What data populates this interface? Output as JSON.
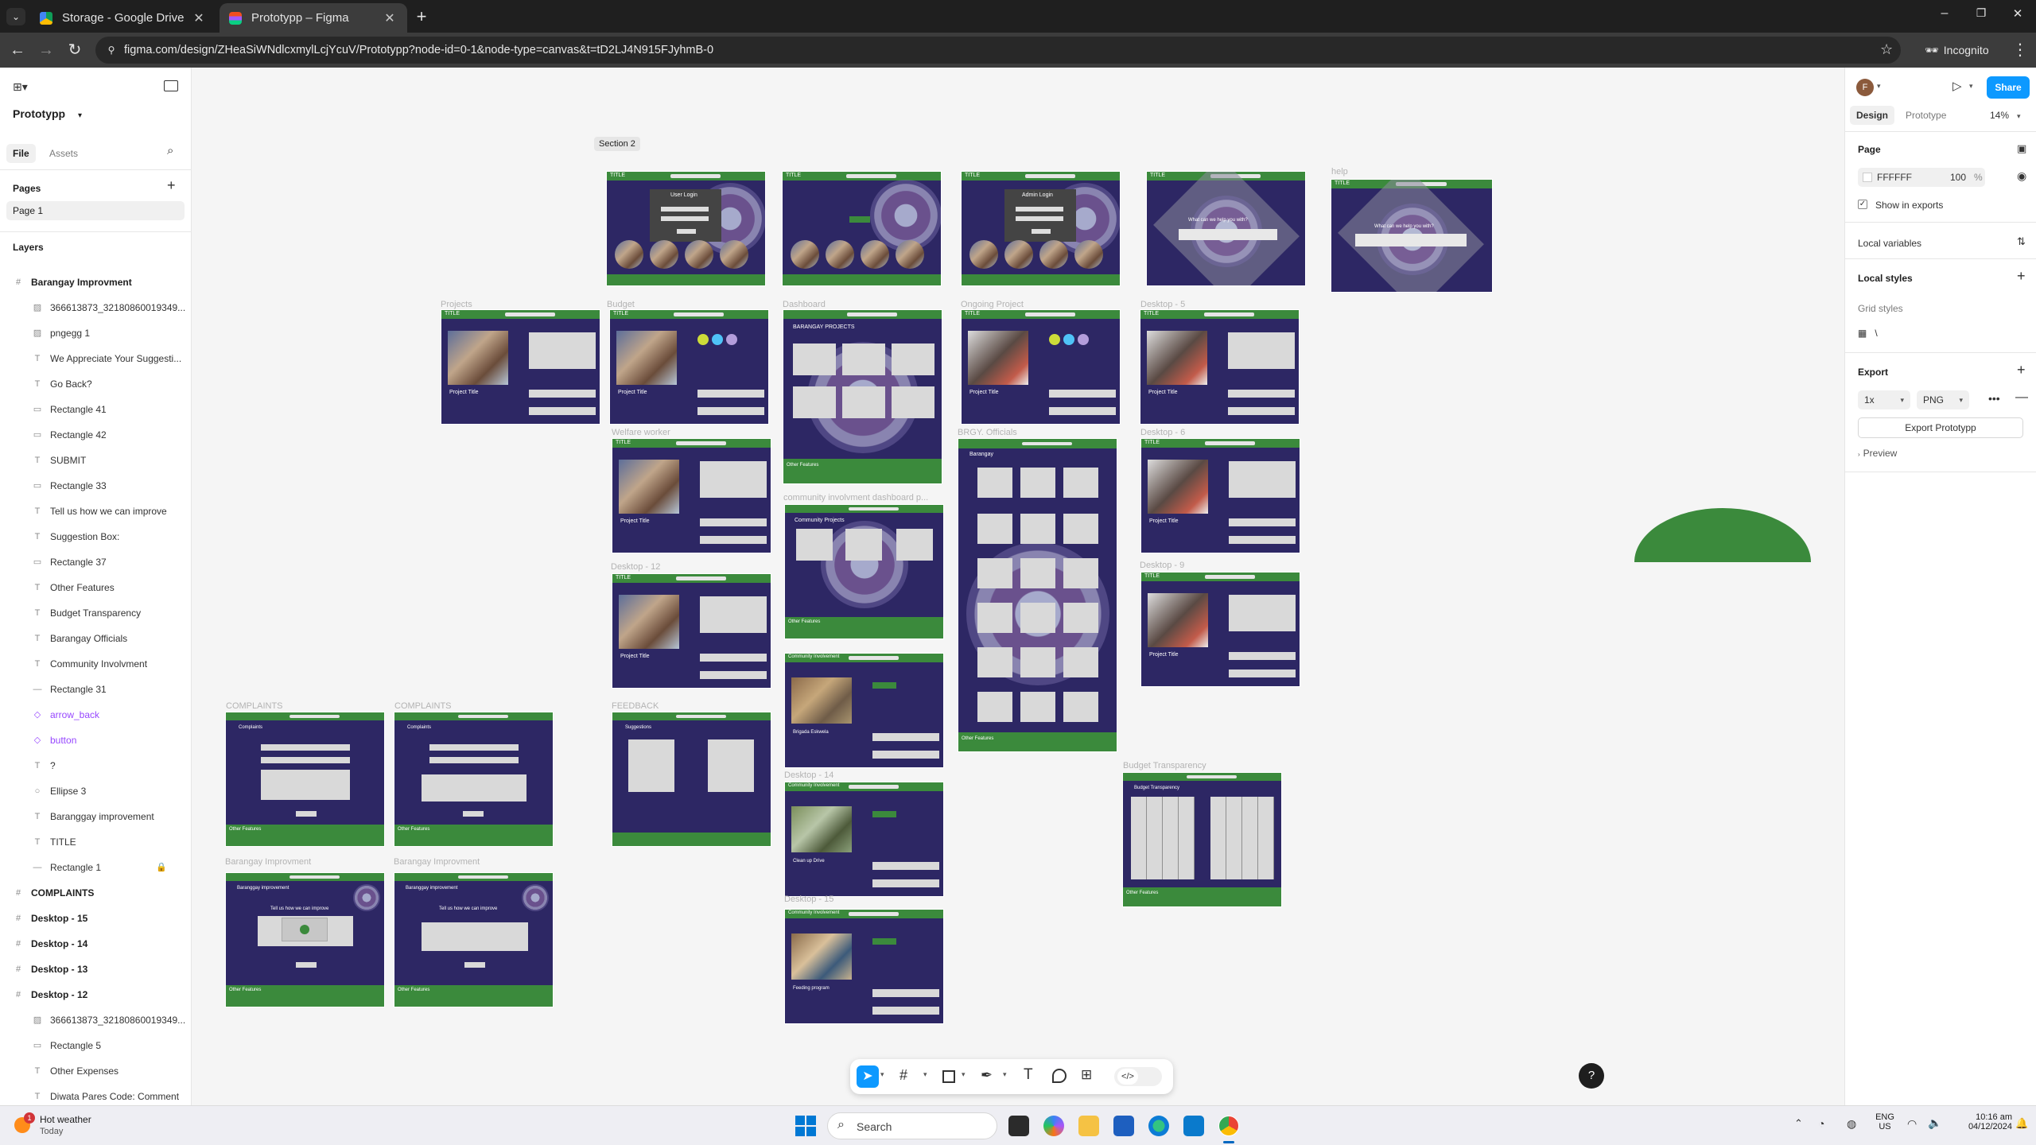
{
  "browser": {
    "tabs": [
      {
        "title": "Storage - Google Drive",
        "active": false
      },
      {
        "title": "Prototypp – Figma",
        "active": true
      }
    ],
    "new_tab": "+",
    "url": "figma.com/design/ZHeaSiWNdlcxmylLcjYcuV/Prototypp?node-id=0-1&node-type=canvas&t=tD2LJ4N915FJyhmB-0",
    "incognito_label": "Incognito",
    "window_controls": [
      "–",
      "❐",
      "✕"
    ]
  },
  "figma_left": {
    "project_name": "Prototypp",
    "tabs": [
      "File",
      "Assets"
    ],
    "pages_header": "Pages",
    "pages": [
      "Page 1"
    ],
    "layers_header": "Layers",
    "layers": [
      {
        "name": "Barangay Improvment",
        "type": "frame"
      },
      {
        "name": "366613873_32180860019349...",
        "type": "image"
      },
      {
        "name": "pngegg 1",
        "type": "image"
      },
      {
        "name": "We Appreciate Your Suggesti...",
        "type": "text"
      },
      {
        "name": "Go Back?",
        "type": "text"
      },
      {
        "name": "Rectangle 41",
        "type": "rect"
      },
      {
        "name": "Rectangle 42",
        "type": "rect"
      },
      {
        "name": "SUBMIT",
        "type": "text"
      },
      {
        "name": "Rectangle 33",
        "type": "rect"
      },
      {
        "name": "Tell us how we can improve",
        "type": "text"
      },
      {
        "name": "Suggestion Box:",
        "type": "text"
      },
      {
        "name": "Rectangle 37",
        "type": "rect"
      },
      {
        "name": "Other Features",
        "type": "text"
      },
      {
        "name": "Budget Transparency",
        "type": "text"
      },
      {
        "name": "Barangay Officials",
        "type": "text"
      },
      {
        "name": "Community Involvment",
        "type": "text"
      },
      {
        "name": "Rectangle 31",
        "type": "line"
      },
      {
        "name": "arrow_back",
        "type": "component"
      },
      {
        "name": "button",
        "type": "component"
      },
      {
        "name": "?",
        "type": "text"
      },
      {
        "name": "Ellipse 3",
        "type": "ellipse"
      },
      {
        "name": "Baranggay improvement",
        "type": "text"
      },
      {
        "name": "TITLE",
        "type": "text"
      },
      {
        "name": "Rectangle 1",
        "type": "line",
        "locked": true
      },
      {
        "name": "COMPLAINTS",
        "type": "frame"
      },
      {
        "name": "Desktop - 15",
        "type": "frame"
      },
      {
        "name": "Desktop - 14",
        "type": "frame"
      },
      {
        "name": "Desktop - 13",
        "type": "frame"
      },
      {
        "name": "Desktop - 12",
        "type": "frame"
      },
      {
        "name": "366613873_32180860019349...",
        "type": "image"
      },
      {
        "name": "Rectangle 5",
        "type": "rect"
      },
      {
        "name": "Other Expenses",
        "type": "text"
      },
      {
        "name": "Diwata Pares Code: Comment",
        "type": "text"
      }
    ]
  },
  "canvas": {
    "section_label": "Section 2",
    "frame_labels": {
      "help": "help",
      "projects": "Projects",
      "budget": "Budget",
      "dashboard": "Dashboard",
      "ongoing": "Ongoing Project",
      "desktop5": "Desktop - 5",
      "welfare": "Welfare worker",
      "brgy": "BRGY. Officials",
      "desktop6": "Desktop - 6",
      "community": "community involvment dashboard p...",
      "desktop12": "Desktop - 12",
      "desktop9": "Desktop - 9",
      "complaints1": "COMPLAINTS",
      "complaints2": "COMPLAINTS",
      "feedback": "FEEDBACK",
      "desktop14": "Desktop - 14",
      "budget_transparency": "Budget Transparency",
      "barangay_imp1": "Barangay Improvment",
      "barangay_imp2": "Barangay Improvment",
      "desktop15": "Desktop - 15"
    },
    "frame_text": {
      "title": "TITLE",
      "user_login": "User Login",
      "admin_login": "Admin Login",
      "help_q": "What can we help you with?",
      "project_title": "Project Title",
      "barangay_projects": "BARANGAY PROJECTS",
      "community_projects": "Community Projects",
      "barangay": "Barangay",
      "complaints": "Complaints",
      "suggestions": "Suggestions",
      "budget_transparency": "Budget Transparency",
      "other_features": "Other Features",
      "barangay_improvement": "Baranggay improvement",
      "tell_us": "Tell us how we can improve",
      "community_involvement": "Community Involvement",
      "brigada": "Brigada Eskwela",
      "cleanup": "Clean up Drive",
      "feeding": "Feeding program"
    }
  },
  "toolbar_bottom": {
    "tools": [
      "move-tool",
      "frame-tool",
      "shape-tool",
      "pen-tool",
      "text-tool",
      "comment-tool",
      "actions-tool",
      "dev-mode-toggle"
    ]
  },
  "figma_right": {
    "avatar_letter": "F",
    "share_label": "Share",
    "tabs": [
      "Design",
      "Prototype"
    ],
    "zoom": "14%",
    "page_header": "Page",
    "page_color": "FFFFFF",
    "page_opacity": "100",
    "page_opacity_unit": "%",
    "show_in_exports": "Show in exports",
    "local_variables": "Local variables",
    "local_styles": "Local styles",
    "grid_styles": "Grid styles",
    "grid_style_name": "\\",
    "export_header": "Export",
    "export_scale": "1x",
    "export_format": "PNG",
    "export_button": "Export Prototypp",
    "preview_label": "Preview",
    "help_label": "?"
  },
  "taskbar": {
    "weather_title": "Hot weather",
    "weather_sub": "Today",
    "weather_badge": "1",
    "search_placeholder": "Search",
    "lang_top": "ENG",
    "lang_bottom": "US",
    "time": "10:16 am",
    "date": "04/12/2024"
  },
  "colors": {
    "frame_navy": "#2d2764",
    "frame_green": "#3b8a3c",
    "figma_blue": "#0d99ff",
    "chrome_dark": "#1f1f1f"
  }
}
